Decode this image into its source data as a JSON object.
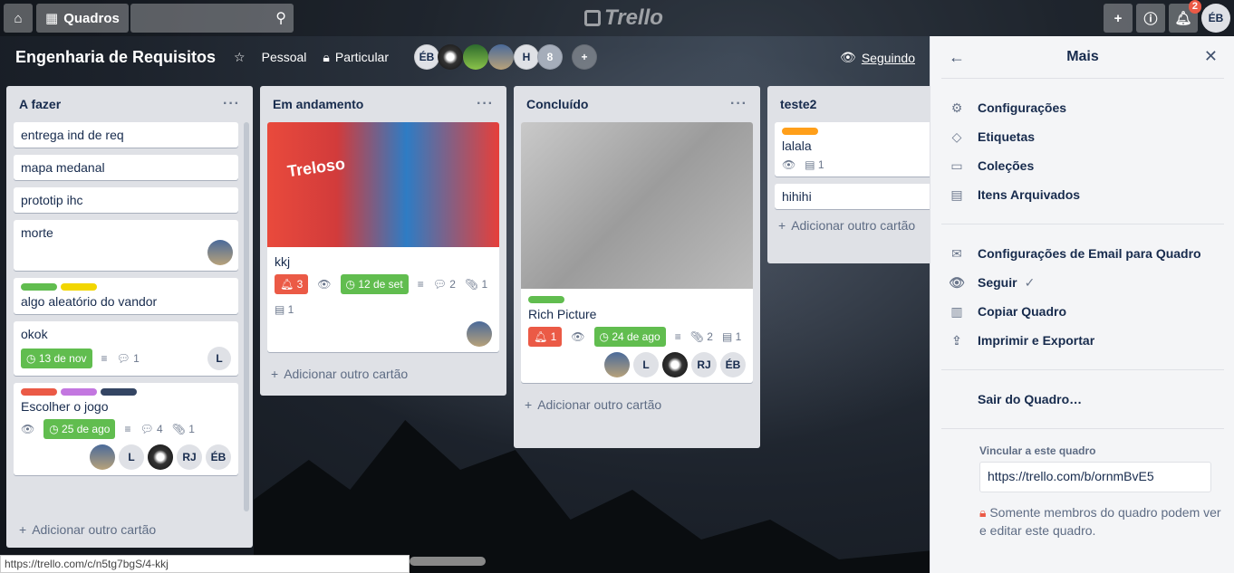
{
  "header": {
    "boards_label": "Quadros",
    "logo_text": "Trello",
    "notification_count": "2",
    "user_initials": "ÉB"
  },
  "board": {
    "title": "Engenharia de Requisitos",
    "team": "Pessoal",
    "visibility": "Particular",
    "members": [
      "ÉB",
      "H",
      "8"
    ],
    "following": "Seguindo"
  },
  "lists": [
    {
      "title": "A fazer",
      "add_label": "Adicionar outro cartão",
      "cards": [
        {
          "title": "entrega ind de req"
        },
        {
          "title": "mapa medanal"
        },
        {
          "title": "prototip ihc"
        },
        {
          "title": "morte"
        },
        {
          "title": "algo aleatório do vandor",
          "labels": [
            "#61bd4f",
            "#f2d600"
          ]
        },
        {
          "title": "okok",
          "due": "13 de nov",
          "comments": "1",
          "member": "L"
        },
        {
          "title": "Escolher o jogo",
          "labels": [
            "#eb5a46",
            "#c377e0",
            "#344563"
          ],
          "due": "25 de ago",
          "comments": "4",
          "attachments": "1",
          "members": [
            "L",
            "RJ",
            "ÉB"
          ]
        }
      ]
    },
    {
      "title": "Em andamento",
      "add_label": "Adicionar outro cartão",
      "cards": [
        {
          "title": "kkj",
          "cover_text": "Treloso",
          "notifications": "3",
          "due": "12 de set",
          "comments": "2",
          "attachments": "1",
          "checklists": "1"
        }
      ]
    },
    {
      "title": "Concluído",
      "add_label": "Adicionar outro cartão",
      "cards": [
        {
          "title": "Rich Picture",
          "labels": [
            "#61bd4f"
          ],
          "notifications": "1",
          "due": "24 de ago",
          "attachments": "2",
          "checklists": "1",
          "members": [
            "L",
            "RJ",
            "ÉB"
          ]
        }
      ]
    },
    {
      "title": "teste2",
      "add_label": "Adicionar outro cartão",
      "cards": [
        {
          "title": "lalala",
          "labels": [
            "#ff9f1a"
          ],
          "checklists": "1"
        },
        {
          "title": "hihihi"
        }
      ]
    }
  ],
  "sidebar": {
    "title": "Mais",
    "items": [
      {
        "label": "Configurações",
        "icon": "gear-icon"
      },
      {
        "label": "Etiquetas",
        "icon": "tag-icon"
      },
      {
        "label": "Coleções",
        "icon": "collection-icon"
      },
      {
        "label": "Itens Arquivados",
        "icon": "archive-icon"
      },
      {
        "label": "Configurações de Email para Quadro",
        "icon": "email-icon"
      },
      {
        "label": "Seguir",
        "icon": "eye-icon"
      },
      {
        "label": "Copiar Quadro",
        "icon": "copy-icon"
      },
      {
        "label": "Imprimir e Exportar",
        "icon": "share-icon"
      },
      {
        "label": "Sair do Quadro…"
      }
    ],
    "link_label": "Vincular a este quadro",
    "link_value": "https://trello.com/b/ornmBvE5",
    "link_note": "Somente membros do quadro podem ver e editar este quadro."
  },
  "status_url": "https://trello.com/c/n5tg7bgS/4-kkj"
}
